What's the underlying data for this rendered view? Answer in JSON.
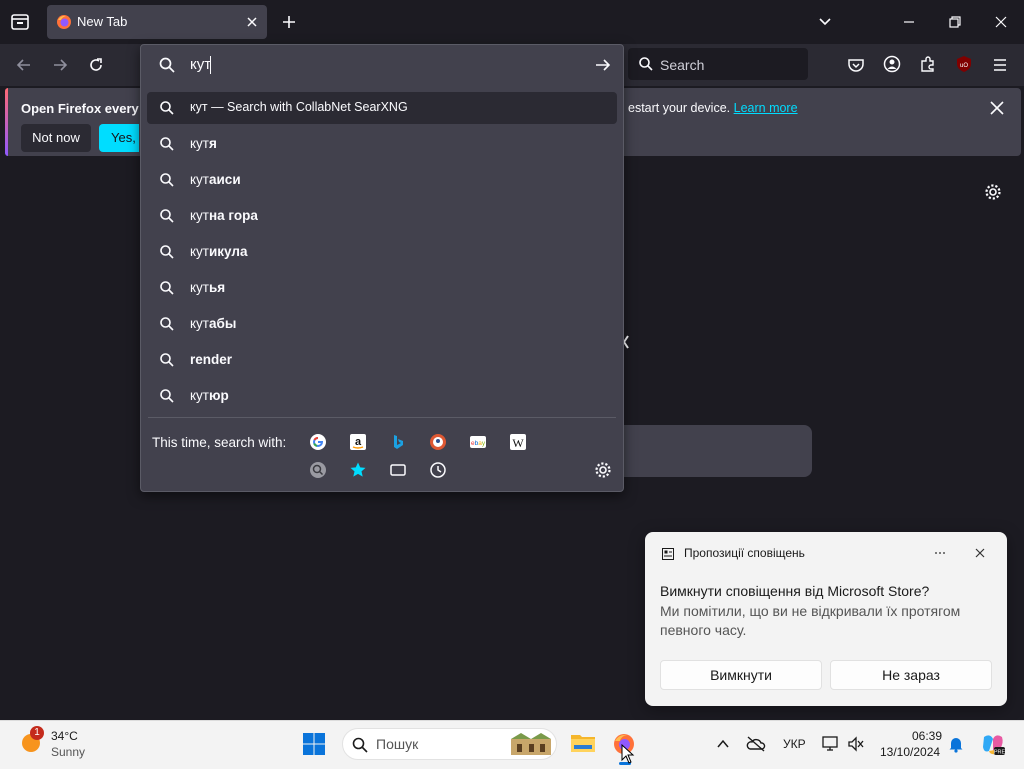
{
  "browser": {
    "tab_title": "New Tab",
    "search_placeholder": "Search"
  },
  "notification_bar": {
    "message_left": "Open Firefox every ti",
    "message_right": "estart your device.",
    "learn_more": "Learn more",
    "not_now": "Not now",
    "yes_label": "Yes, c"
  },
  "urlbar": {
    "typed_text": "кут",
    "search_with_row": {
      "prefix": "кут",
      "suffix": " — Search with CollabNet SearXNG"
    },
    "suggestions": [
      {
        "typed": "кут",
        "completion": "я"
      },
      {
        "typed": "кут",
        "completion": "аиси"
      },
      {
        "typed": "кут",
        "completion": "на гора"
      },
      {
        "typed": "кут",
        "completion": "икула"
      },
      {
        "typed": "кут",
        "completion": "ья"
      },
      {
        "typed": "кут",
        "completion": "абы"
      },
      {
        "typed": "",
        "completion": "render"
      },
      {
        "typed": "кут",
        "completion": "юр"
      }
    ],
    "this_time_label": "This time, search with:",
    "engines": [
      "google-icon",
      "amazon-icon",
      "bing-icon",
      "duckduckgo-icon",
      "ebay-icon",
      "wikipedia-icon",
      "searxng-icon",
      "bookmarks-icon",
      "tabs-icon",
      "history-icon"
    ]
  },
  "toast": {
    "header": "Пропозиції сповіщень",
    "title": "Вимкнути сповіщення від Microsoft Store?",
    "body": "Ми помітили, що ви не відкривали їх протягом певного часу.",
    "primary_button": "Вимкнути",
    "secondary_button": "Не зараз"
  },
  "taskbar": {
    "weather_temp": "34°C",
    "weather_desc": "Sunny",
    "weather_badge": "1",
    "search_placeholder": "Пошук",
    "language": "УКР",
    "time": "06:39",
    "date": "13/10/2024"
  },
  "colors": {
    "accent": "#00ddff",
    "panel": "#42414d",
    "toolbar": "#2b2a33",
    "background": "#1c1b22"
  }
}
